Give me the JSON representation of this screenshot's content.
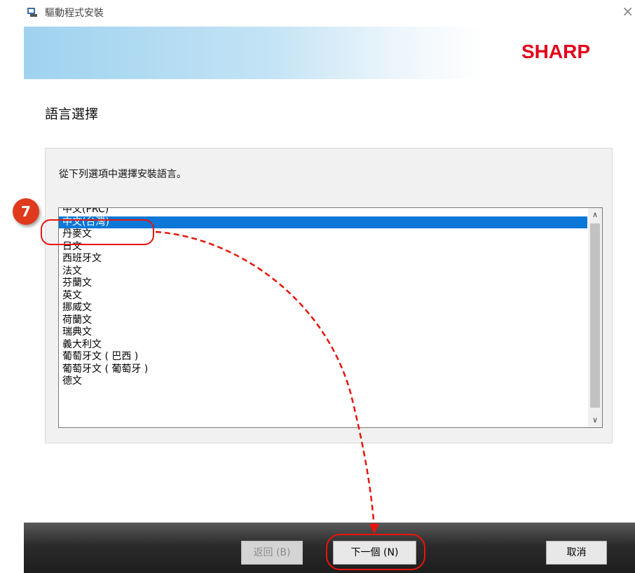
{
  "window": {
    "title": "驅動程式安裝",
    "close_glyph": "×"
  },
  "banner": {
    "logo_text": "SHARP"
  },
  "page": {
    "heading": "語言選擇",
    "instruction": "從下列選項中選擇安裝語言。"
  },
  "language_list": {
    "items": [
      "中文(PRC)",
      "中文(台灣)",
      "丹麥文",
      "日文",
      "西班牙文",
      "法文",
      "芬蘭文",
      "英文",
      "挪威文",
      "荷蘭文",
      "瑞典文",
      "義大利文",
      "葡萄牙文 ( 巴西 )",
      "葡萄牙文 ( 葡萄牙 )",
      "德文"
    ],
    "selected_index": 1,
    "scroll_up_glyph": "∧",
    "scroll_down_glyph": "∨"
  },
  "buttons": {
    "back": "返回 (B)",
    "next": "下一個 (N)",
    "cancel": "取消"
  },
  "annotation": {
    "step_number": "7"
  },
  "colors": {
    "selection": "#0b78d7",
    "logo": "#e2001a",
    "annotation_red": "#e8140c"
  }
}
